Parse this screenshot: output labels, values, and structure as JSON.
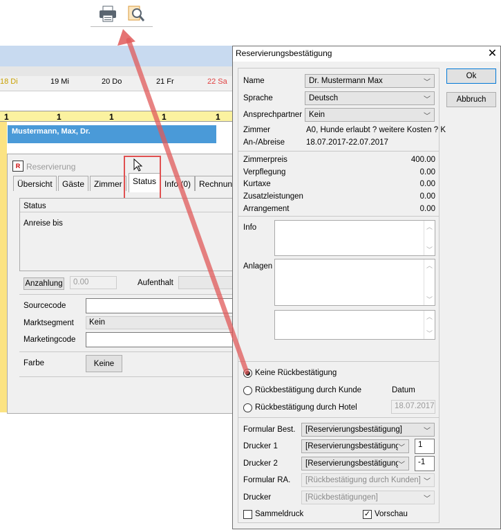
{
  "toolbar": {
    "print_icon": "printer-icon",
    "preview_icon": "print-preview-icon"
  },
  "calendar": {
    "days": [
      "18 Di",
      "19 Mi",
      "20 Do",
      "21 Fr",
      "22 Sa"
    ],
    "day_colors": [
      "#c8a000",
      "#000000",
      "#000000",
      "#000000",
      "#e04040"
    ],
    "counts": [
      "1",
      "1",
      "1",
      "1",
      "1"
    ],
    "booking_name": "Mustermann, Max, Dr."
  },
  "reservation": {
    "title": "Reservierung",
    "tabs": [
      "Übersicht",
      "Gäste",
      "Zimmer",
      "Status",
      "Info (0)",
      "Rechnung"
    ],
    "status_group": "Status",
    "arrival_label": "Anreise bis",
    "deposit_button": "Anzahlung",
    "deposit_value": "0.00",
    "stay_label": "Aufenthalt",
    "sourcecode_label": "Sourcecode",
    "market_segment_label": "Marktsegment",
    "market_segment_value": "Kein",
    "marketingcode_label": "Marketingcode",
    "color_label": "Farbe",
    "color_button": "Keine"
  },
  "dialog": {
    "title": "Reservierungsbestätigung",
    "ok": "Ok",
    "cancel": "Abbruch",
    "name_label": "Name",
    "name_value": "Dr. Mustermann Max",
    "language_label": "Sprache",
    "language_value": "Deutsch",
    "contact_label": "Ansprechpartner",
    "contact_value": "Kein",
    "room_label": "Zimmer",
    "room_value": "A0, Hunde erlaubt ? weitere Kosten ? K",
    "dates_label": "An-/Abreise",
    "dates_value": "18.07.2017-22.07.2017",
    "amounts": [
      {
        "label": "Zimmerpreis",
        "value": "400.00"
      },
      {
        "label": "Verpflegung",
        "value": "0.00"
      },
      {
        "label": "Kurtaxe",
        "value": "0.00"
      },
      {
        "label": "Zusatzleistungen",
        "value": "0.00"
      },
      {
        "label": "Arrangement",
        "value": "0.00"
      }
    ],
    "info_label": "Info",
    "attachments_label": "Anlagen",
    "radio_none": "Keine Rückbestätigung",
    "radio_customer": "Rückbestätigung durch Kunde",
    "radio_hotel": "Rückbestätigung durch Hotel",
    "date_label": "Datum",
    "date_value": "18.07.2017",
    "form_label": "Formular Best.",
    "form_value": "[Reservierungsbestätigung]",
    "printer1_label": "Drucker 1",
    "printer1_value": "[Reservierungsbestätigungen",
    "printer1_count": "1",
    "printer2_label": "Drucker 2",
    "printer2_value": "[Reservierungsbestätigungen",
    "printer2_count": "-1",
    "form_ra_label": "Formular RA.",
    "form_ra_value": "[Rückbestätigung durch Kunden]",
    "printer_label": "Drucker",
    "printer_value": "[Rückbestätigungen]",
    "batch_label": "Sammeldruck",
    "preview_label": "Vorschau"
  }
}
